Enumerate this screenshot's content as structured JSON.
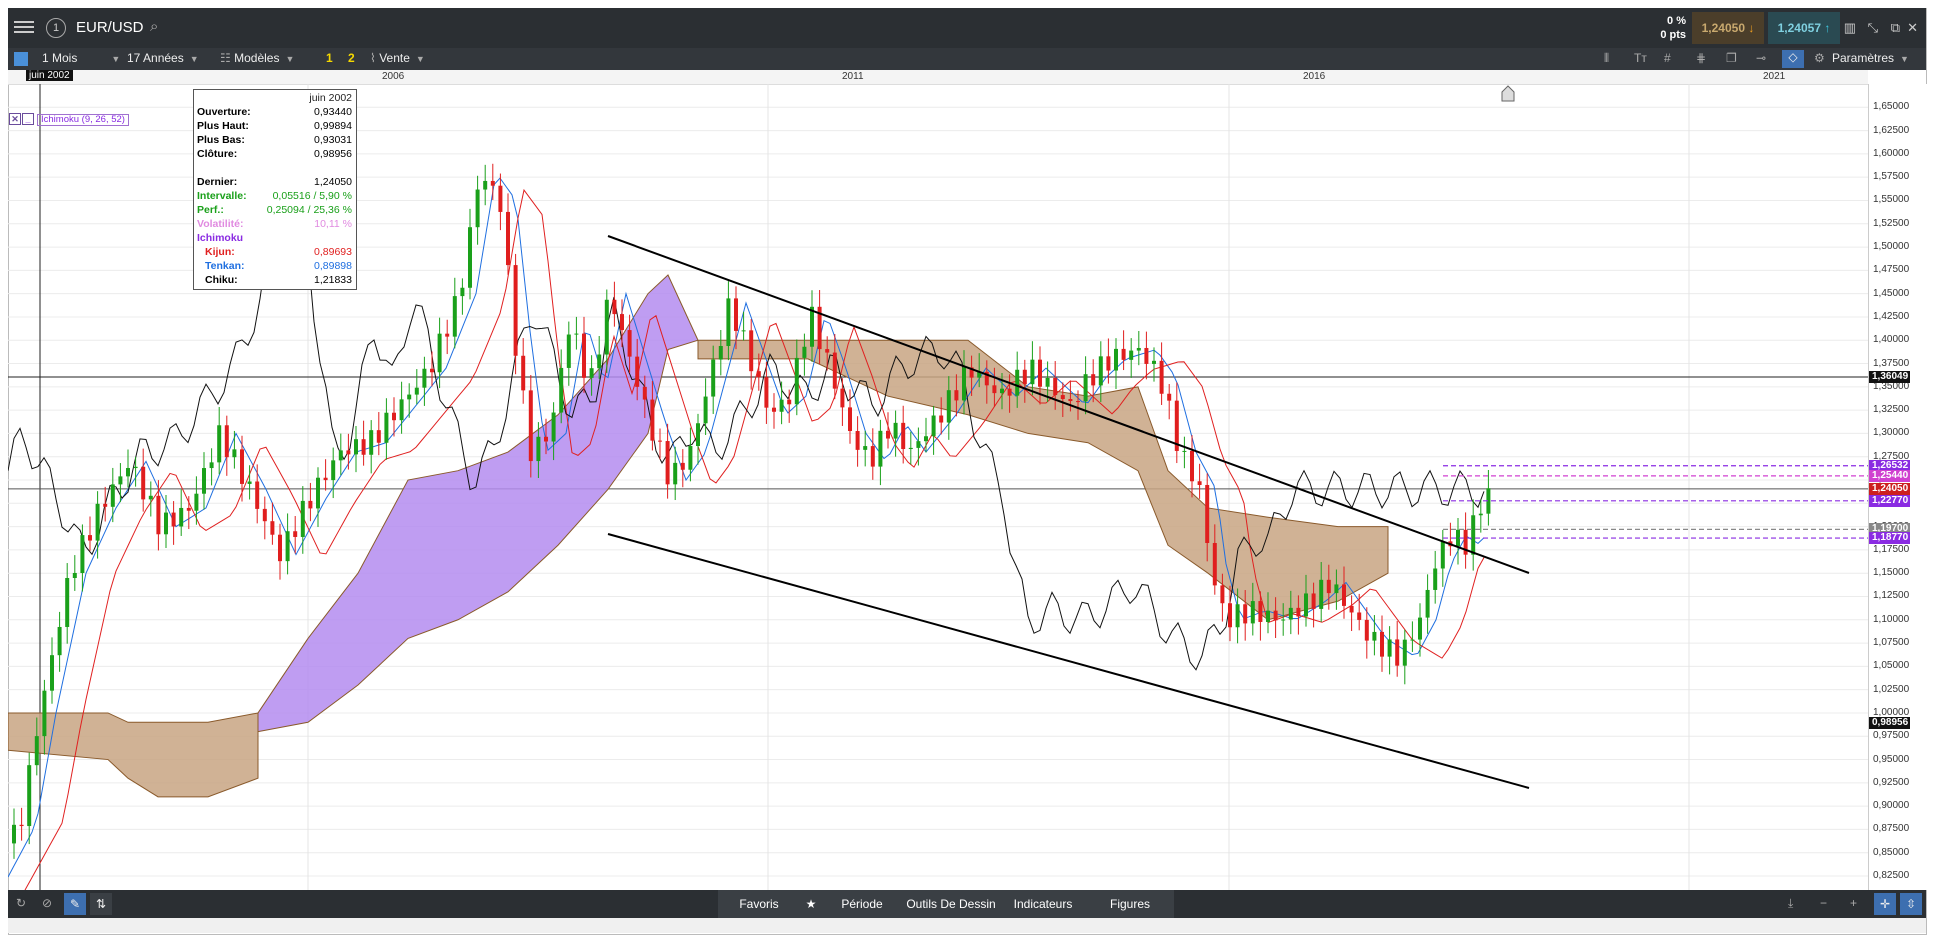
{
  "titlebar": {
    "symbol": "EUR/USD",
    "change_pct": "0 %",
    "change_pts": "0 pts",
    "bid": "1,24050",
    "ask": "1,24057",
    "menu_icon": "hamburger-icon",
    "info_icon": "info-circle-icon",
    "search_icon": "search-icon"
  },
  "toolbar": {
    "interval": "1 Mois",
    "range": "17 Années",
    "templates": "Modèles",
    "preset1": "1",
    "preset2": "2",
    "order": "Vente",
    "settings": "Paramètres"
  },
  "timeaxis": {
    "cursor": "juin 2002",
    "labels": [
      "2006",
      "2011",
      "2016",
      "2021"
    ]
  },
  "indicator_legend": {
    "name": "Ichimoku (9, 26, 52)"
  },
  "infobox": {
    "date": "juin 2002",
    "rows": [
      {
        "k": "Ouverture:",
        "v": "0,93440",
        "color": "#000000"
      },
      {
        "k": "Plus Haut:",
        "v": "0,99894",
        "color": "#000000"
      },
      {
        "k": "Plus Bas:",
        "v": "0,93031",
        "color": "#000000"
      },
      {
        "k": "Clôture:",
        "v": "0,98956",
        "color": "#000000"
      },
      {
        "k": "",
        "v": "",
        "color": "#000000"
      },
      {
        "k": "Dernier:",
        "v": "1,24050",
        "color": "#000000"
      },
      {
        "k": "Intervalle:",
        "v": "0,05516 / 5,90 %",
        "color": "#1aa01a"
      },
      {
        "k": "Perf.:",
        "v": "0,25094 / 25,36 %",
        "color": "#1aa01a"
      },
      {
        "k": "Volatilité:",
        "v": "10,11 %",
        "color": "#e08ae0"
      },
      {
        "k": "Ichimoku",
        "v": "",
        "color": "#8a2be2"
      },
      {
        "k": "Kijun:",
        "v": "0,89693",
        "color": "#e02020"
      },
      {
        "k": "Tenkan:",
        "v": "0,89898",
        "color": "#1f6fe0"
      },
      {
        "k": "Chiku:",
        "v": "1,21833",
        "color": "#000000"
      }
    ]
  },
  "price_axis": {
    "labels": [
      "1,65000",
      "1,62500",
      "1,60000",
      "1,57500",
      "1,55000",
      "1,52500",
      "1,50000",
      "1,47500",
      "1,45000",
      "1,42500",
      "1,40000",
      "1,37500",
      "1,35000",
      "1,32500",
      "1,30000",
      "1,27500",
      "1,25000",
      "1,22500",
      "1,20000",
      "1,17500",
      "1,15000",
      "1,12500",
      "1,10000",
      "1,07500",
      "1,05000",
      "1,02500",
      "1,00000",
      "0,97500",
      "0,95000",
      "0,92500",
      "0,90000",
      "0,87500",
      "0,85000",
      "0,82500"
    ],
    "flags": [
      {
        "value": "1,36049",
        "color": "#111111"
      },
      {
        "value": "1,26532",
        "color": "#8a2be2"
      },
      {
        "value": "1,25440",
        "color": "#d040d0"
      },
      {
        "value": "1,24050",
        "color": "#cc1f1f"
      },
      {
        "value": "1,22770",
        "color": "#8a2be2"
      },
      {
        "value": "1,19700",
        "color": "#888888"
      },
      {
        "value": "1,18770",
        "color": "#8a2be2"
      },
      {
        "value": "0,98956",
        "color": "#111111"
      }
    ]
  },
  "bottombar": {
    "tabs": [
      "Favoris",
      "Période",
      "Outils De Dessin",
      "Indicateurs",
      "Figures"
    ]
  },
  "colors": {
    "up": "#1aa01a",
    "down": "#e01e1e",
    "kijun": "#e02020",
    "tenkan": "#1f6fe0",
    "chiku": "#111111",
    "kumo_bull": "#b48cf0",
    "kumo_bear": "#c8a482"
  }
}
